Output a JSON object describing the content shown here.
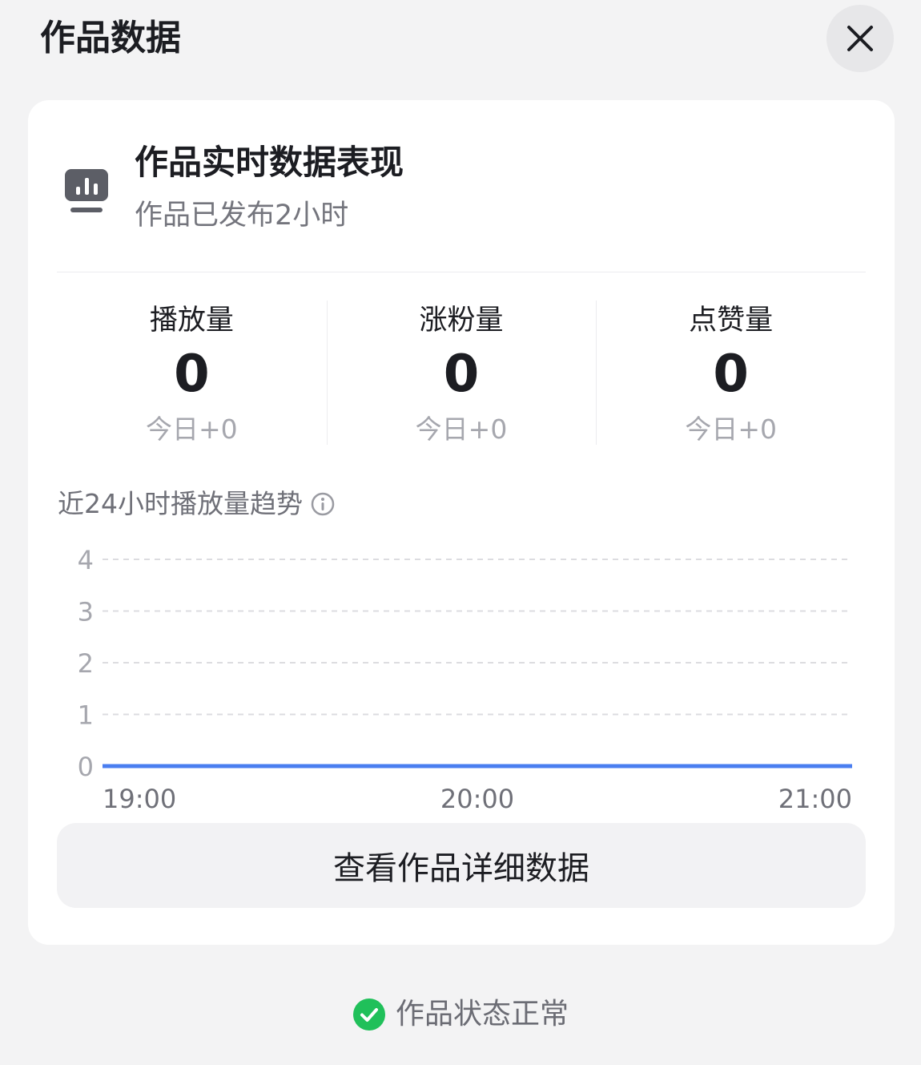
{
  "page": {
    "title": "作品数据"
  },
  "header": {
    "title": "作品实时数据表现",
    "subtitle": "作品已发布2小时"
  },
  "stats": [
    {
      "label": "播放量",
      "value": "0",
      "today": "今日+0"
    },
    {
      "label": "涨粉量",
      "value": "0",
      "today": "今日+0"
    },
    {
      "label": "点赞量",
      "value": "0",
      "today": "今日+0"
    }
  ],
  "trend": {
    "title": "近24小时播放量趋势"
  },
  "chart_data": {
    "type": "line",
    "x": [
      "19:00",
      "20:00",
      "21:00"
    ],
    "series": [
      {
        "values": [
          0,
          0,
          0
        ],
        "color": "#4a7ef0"
      }
    ],
    "ylim": [
      0,
      4
    ],
    "yticks": [
      0,
      1,
      2,
      3,
      4
    ],
    "grid": true
  },
  "actions": {
    "detail_label": "查看作品详细数据"
  },
  "status": {
    "text": "作品状态正常",
    "color": "#20c05a"
  },
  "icons": {
    "close": "close-icon",
    "chart": "chart-icon",
    "info": "info-icon",
    "check": "check-circle-icon"
  }
}
